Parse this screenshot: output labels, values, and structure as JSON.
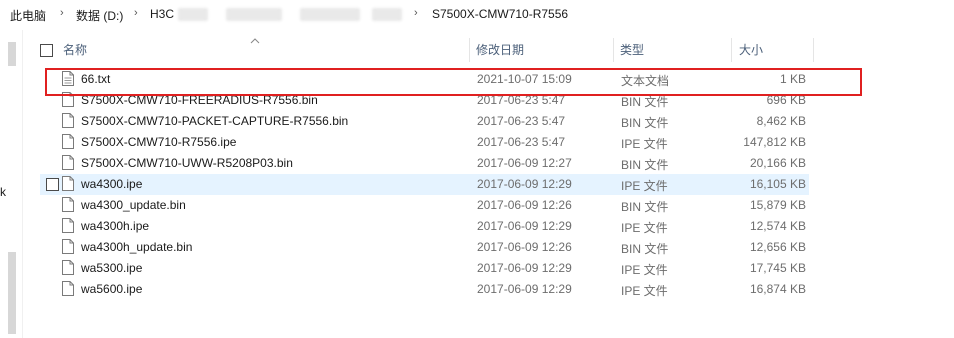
{
  "breadcrumb": {
    "items": [
      "此电脑",
      "数据 (D:)",
      "H3C",
      "S7500X-CMW710-R7556"
    ],
    "separator": "›"
  },
  "nav": {
    "partial_label": "k"
  },
  "columns": {
    "name": "名称",
    "date": "修改日期",
    "type": "类型",
    "size": "大小"
  },
  "files": [
    {
      "name": "66.txt",
      "date": "2021-10-07 15:09",
      "type": "文本文档",
      "size": "1 KB"
    },
    {
      "name": "S7500X-CMW710-FREERADIUS-R7556.bin",
      "date": "2017-06-23 5:47",
      "type": "BIN 文件",
      "size": "696 KB"
    },
    {
      "name": "S7500X-CMW710-PACKET-CAPTURE-R7556.bin",
      "date": "2017-06-23 5:47",
      "type": "BIN 文件",
      "size": "8,462 KB"
    },
    {
      "name": "S7500X-CMW710-R7556.ipe",
      "date": "2017-06-23 5:47",
      "type": "IPE 文件",
      "size": "147,812 KB"
    },
    {
      "name": "S7500X-CMW710-UWW-R5208P03.bin",
      "date": "2017-06-09 12:27",
      "type": "BIN 文件",
      "size": "20,166 KB"
    },
    {
      "name": "wa4300.ipe",
      "date": "2017-06-09 12:29",
      "type": "IPE 文件",
      "size": "16,105 KB"
    },
    {
      "name": "wa4300_update.bin",
      "date": "2017-06-09 12:26",
      "type": "BIN 文件",
      "size": "15,879 KB"
    },
    {
      "name": "wa4300h.ipe",
      "date": "2017-06-09 12:29",
      "type": "IPE 文件",
      "size": "12,574 KB"
    },
    {
      "name": "wa4300h_update.bin",
      "date": "2017-06-09 12:26",
      "type": "BIN 文件",
      "size": "12,656 KB"
    },
    {
      "name": "wa5300.ipe",
      "date": "2017-06-09 12:29",
      "type": "IPE 文件",
      "size": "17,745 KB"
    },
    {
      "name": "wa5600.ipe",
      "date": "2017-06-09 12:29",
      "type": "IPE 文件",
      "size": "16,874 KB"
    }
  ],
  "icons": {
    "file": "file-icon",
    "sort": "sort-up-icon"
  },
  "colors": {
    "highlight": "#e02020",
    "hover": "#e5f3ff",
    "header_text": "#4c607a"
  }
}
